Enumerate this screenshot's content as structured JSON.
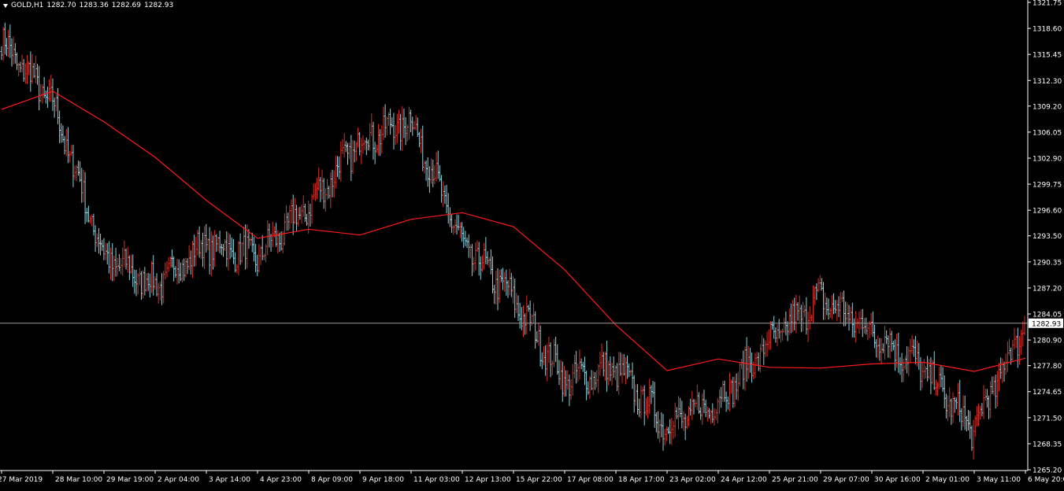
{
  "header": {
    "symbol": "GOLD,H1",
    "open": "1282.70",
    "high": "1283.36",
    "low": "1282.69",
    "close": "1282.93"
  },
  "colors": {
    "background": "#000000",
    "bull_bar": "#d9302a",
    "bear_bar": "#8fd3df",
    "moving_average": "#ff1a1a",
    "price_line": "#9a9a9a",
    "axis": "#ffffff",
    "price_label_bg": "#ffffff",
    "price_label_text": "#000000"
  },
  "price_axis": {
    "ticks": [
      "1321.75",
      "1318.60",
      "1315.45",
      "1312.30",
      "1309.20",
      "1306.05",
      "1302.90",
      "1299.75",
      "1296.60",
      "1293.50",
      "1290.35",
      "1287.20",
      "1284.05",
      "1280.90",
      "1277.80",
      "1274.65",
      "1271.50",
      "1268.35",
      "1265.20"
    ],
    "current_price_label": "1282.93"
  },
  "time_axis": {
    "labels": [
      "27 Mar 2019",
      "28 Mar 10:00",
      "29 Mar 19:00",
      "2 Apr 04:00",
      "3 Apr 14:00",
      "4 Apr 23:00",
      "8 Apr 09:00",
      "9 Apr 18:00",
      "11 Apr 03:00",
      "12 Apr 13:00",
      "15 Apr 22:00",
      "17 Apr 08:00",
      "18 Apr 17:00",
      "23 Apr 02:00",
      "24 Apr 12:00",
      "25 Apr 21:00",
      "29 Apr 07:00",
      "30 Apr 16:00",
      "2 May 01:00",
      "3 May 11:00",
      "6 May 20:00"
    ]
  },
  "chart_data": {
    "type": "line",
    "instrument": "GOLD",
    "timeframe": "H1",
    "ylim": [
      1265.2,
      1321.75
    ],
    "current_price": 1282.93,
    "categories": [
      "27 Mar 2019",
      "28 Mar 10:00",
      "29 Mar 19:00",
      "2 Apr 04:00",
      "3 Apr 14:00",
      "4 Apr 23:00",
      "8 Apr 09:00",
      "9 Apr 18:00",
      "11 Apr 03:00",
      "12 Apr 13:00",
      "15 Apr 22:00",
      "17 Apr 08:00",
      "18 Apr 17:00",
      "23 Apr 02:00",
      "24 Apr 12:00",
      "25 Apr 21:00",
      "29 Apr 07:00",
      "30 Apr 16:00",
      "2 May 01:00",
      "3 May 11:00",
      "6 May 20:00"
    ],
    "series": [
      {
        "values": [
          1317.0,
          1309.5,
          1291.0,
          1287.5,
          1292.5,
          1291.0,
          1297.0,
          1305.0,
          1307.5,
          1292.5,
          1286.0,
          1276.0,
          1277.5,
          1270.5,
          1273.5,
          1280.5,
          1286.0,
          1282.0,
          1277.5,
          1270.0,
          1282.93
        ]
      },
      {
        "values": [
          1308.8,
          1311.0,
          1307.3,
          1303.0,
          1297.8,
          1293.2,
          1294.3,
          1293.6,
          1295.5,
          1296.3,
          1294.6,
          1289.4,
          1282.7,
          1277.2,
          1278.6,
          1277.6,
          1277.5,
          1278.0,
          1278.2,
          1277.1,
          1278.7
        ]
      }
    ]
  }
}
